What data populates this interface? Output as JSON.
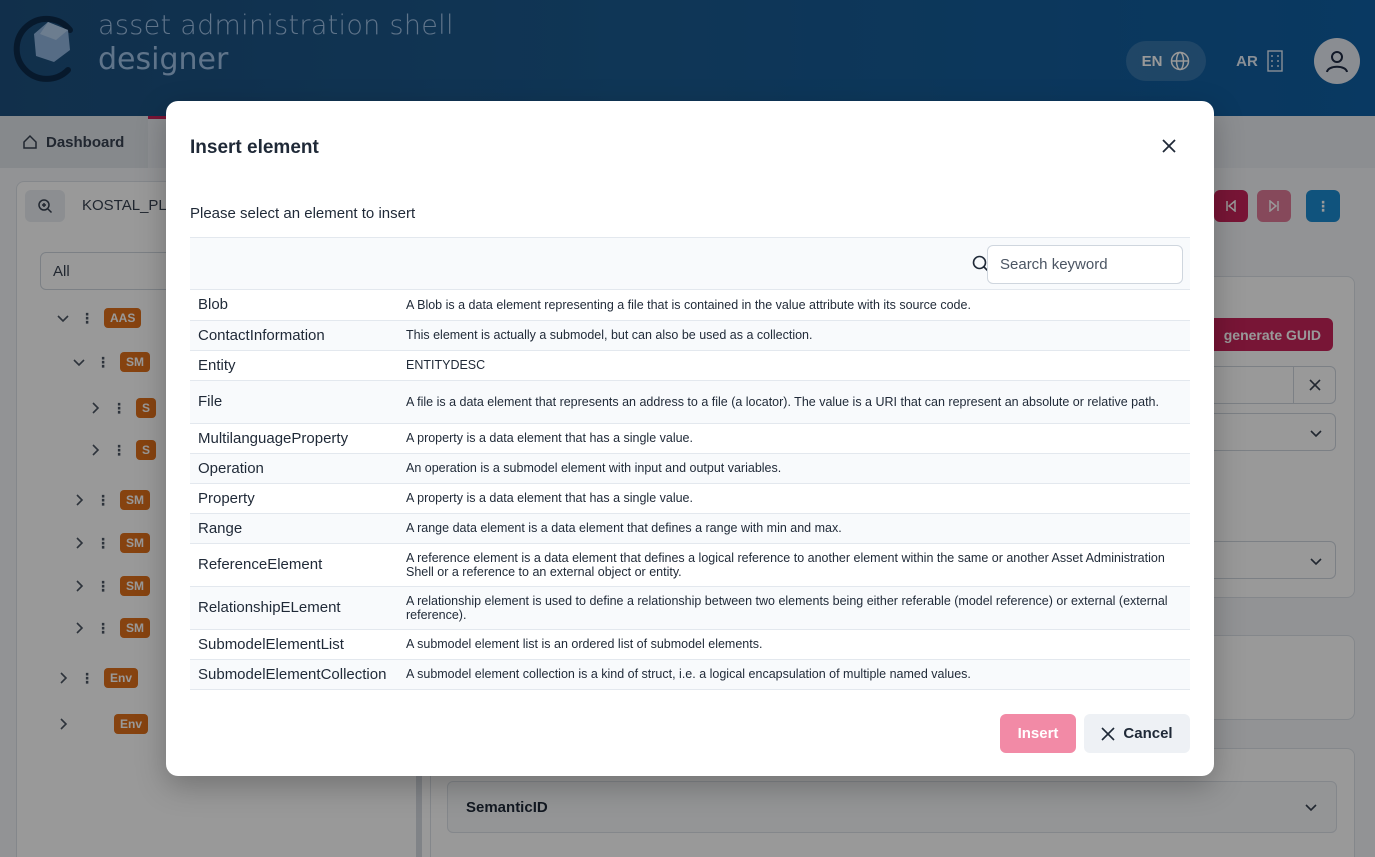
{
  "header": {
    "brand_line1": "asset administration shell",
    "brand_line2": "designer",
    "lang_en": "EN",
    "lang_ar": "AR"
  },
  "background": {
    "tab_dashboard": "Dashboard",
    "tree_title": "KOSTAL_PL",
    "filter_value": "All",
    "generate_guid": "generate GUID",
    "semantic_id": "SemanticID",
    "tree": [
      {
        "tag": "AAS"
      },
      {
        "tag": "SM"
      },
      {
        "tag": "S"
      },
      {
        "tag": "S"
      },
      {
        "tag": "SM"
      },
      {
        "tag": "SM"
      },
      {
        "tag": "SM"
      },
      {
        "tag": "SM"
      },
      {
        "tag": "Env"
      },
      {
        "tag": "Env"
      }
    ]
  },
  "modal": {
    "title": "Insert element",
    "subtitle": "Please select an element to insert",
    "search_placeholder": "Search keyword",
    "insert_label": "Insert",
    "cancel_label": "Cancel",
    "rows": [
      {
        "name": "Blob",
        "desc": "A Blob is a data element representing a file that is contained in the value attribute with its source code."
      },
      {
        "name": "ContactInformation",
        "desc": "This element is actually a submodel, but can also be used as a collection."
      },
      {
        "name": "Entity",
        "desc": "ENTITYDESC"
      },
      {
        "name": "File",
        "desc": "A file is a data element that represents an address to a file (a locator). The value is a URI that can represent an absolute or relative path."
      },
      {
        "name": "MultilanguageProperty",
        "desc": "A property is a data element that has a single value."
      },
      {
        "name": "Operation",
        "desc": "An operation is a submodel element with input and output variables."
      },
      {
        "name": "Property",
        "desc": "A property is a data element that has a single value."
      },
      {
        "name": "Range",
        "desc": "A range data element is a data element that defines a range with min and max."
      },
      {
        "name": "ReferenceElement",
        "desc": "A reference element is a data element that defines a logical reference to another element within the same or another Asset Administration Shell or a reference to an external object or entity."
      },
      {
        "name": "RelationshipELement",
        "desc": "A relationship element is used to define a relationship between two elements being either referable (model reference) or external (external reference)."
      },
      {
        "name": "SubmodelElementList",
        "desc": "A submodel element list is an ordered list of submodel elements."
      },
      {
        "name": "SubmodelElementCollection",
        "desc": "A submodel element collection is a kind of struct, i.e. a logical encapsulation of multiple named values."
      }
    ]
  },
  "colors": {
    "header_start": "#1d4f7d",
    "header_end": "#0f5fa3",
    "accent": "#c8245a",
    "insert_disabled": "#f28aa6",
    "tag_orange": "#e0701b"
  }
}
